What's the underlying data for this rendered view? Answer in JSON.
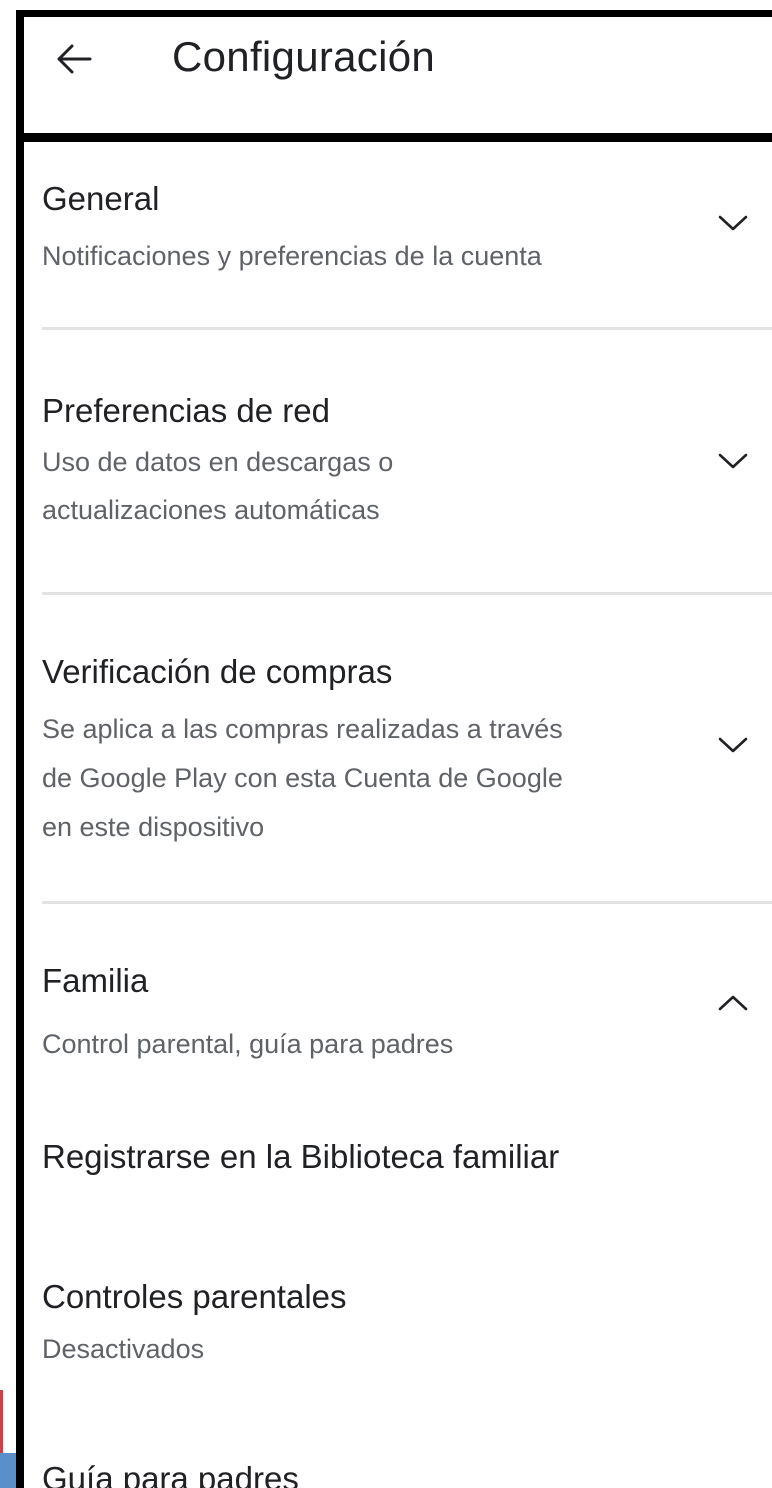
{
  "header": {
    "title": "Configuración",
    "back_icon": "arrow-back-icon"
  },
  "sections": [
    {
      "title": "General",
      "subtitle": "Notificaciones y preferencias de la cuenta",
      "expanded": false
    },
    {
      "title": "Preferencias de red",
      "subtitle_lines": [
        "Uso de datos en descargas o",
        "actualizaciones automáticas"
      ],
      "expanded": false
    },
    {
      "title": "Verificación de compras",
      "subtitle_lines": [
        "Se aplica a las compras realizadas a través",
        "de Google Play con esta Cuenta de Google",
        "en este dispositivo"
      ],
      "expanded": false
    },
    {
      "title": "Familia",
      "subtitle": "Control parental, guía para padres",
      "expanded": true,
      "items": [
        {
          "title": "Registrarse en la Biblioteca familiar"
        },
        {
          "title": "Controles parentales",
          "subtitle": "Desactivados"
        },
        {
          "title": "Guía para padres"
        }
      ]
    }
  ],
  "colors": {
    "text_primary": "#202124",
    "text_secondary": "#5f6368",
    "divider": "#e3e3e3",
    "frame": "#000000"
  }
}
